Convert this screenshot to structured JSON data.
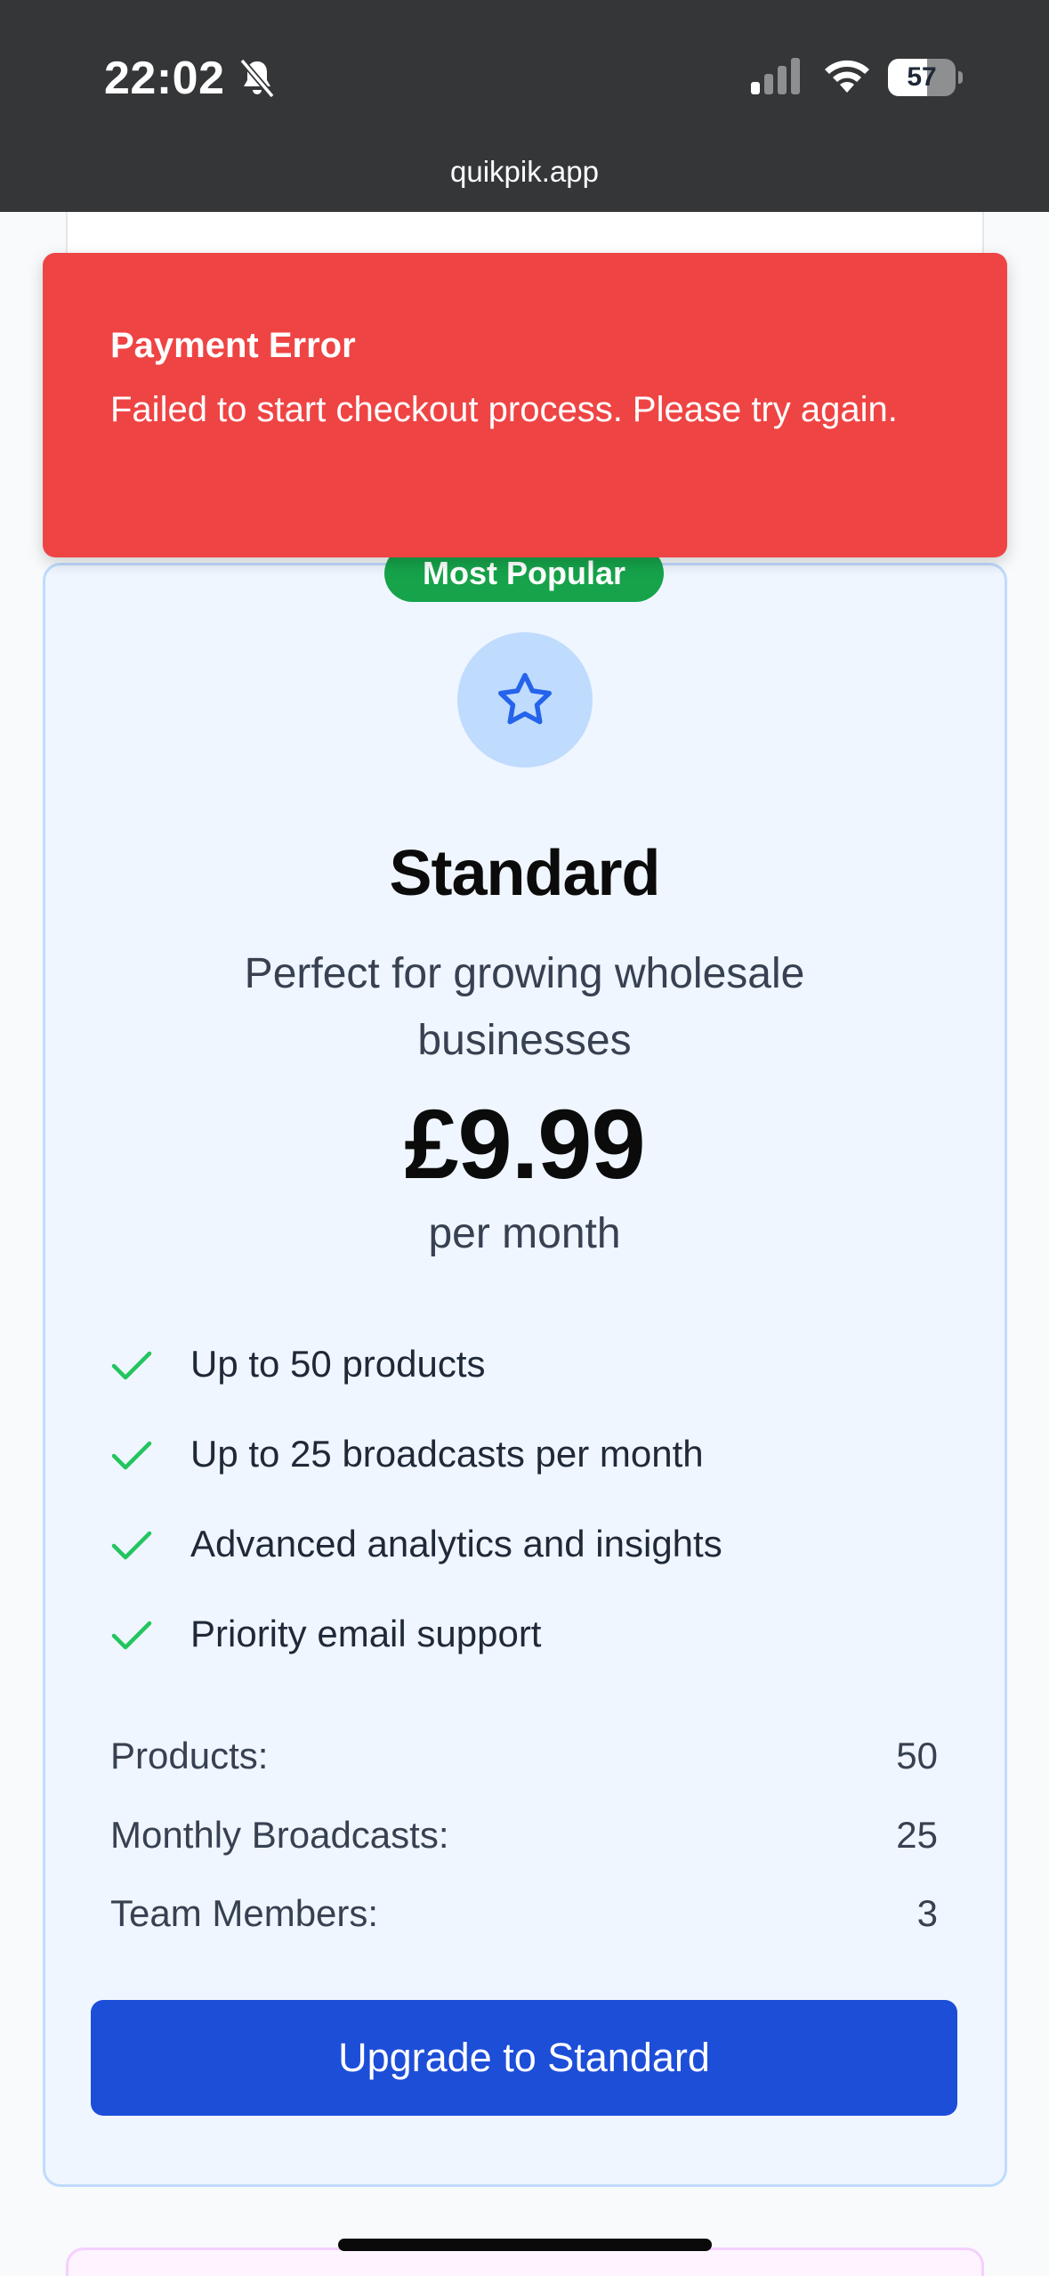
{
  "status_bar": {
    "time": "22:02",
    "battery": "57",
    "icons": [
      "bell-off-icon",
      "cellular-signal-icon",
      "wifi-icon",
      "battery-icon"
    ]
  },
  "browser": {
    "url": "quikpik.app"
  },
  "toast": {
    "title": "Payment Error",
    "message": "Failed to start checkout process. Please try again."
  },
  "plan": {
    "badge": "Most Popular",
    "icon": "star-icon",
    "name": "Standard",
    "description": "Perfect for growing wholesale businesses",
    "price": "£9.99",
    "period": "per month",
    "features": [
      "Up to 50 products",
      "Up to 25 broadcasts per month",
      "Advanced analytics and insights",
      "Priority email support"
    ],
    "limits": [
      {
        "label": "Products:",
        "value": "50"
      },
      {
        "label": "Monthly Broadcasts:",
        "value": "25"
      },
      {
        "label": "Team Members:",
        "value": "3"
      }
    ],
    "button_label": "Upgrade to Standard"
  },
  "colors": {
    "toast_bg": "#ef4444",
    "badge_bg": "#16a34a",
    "button_bg": "#1d4ed8",
    "card_bg": "#eff6ff",
    "check": "#22c55e"
  }
}
